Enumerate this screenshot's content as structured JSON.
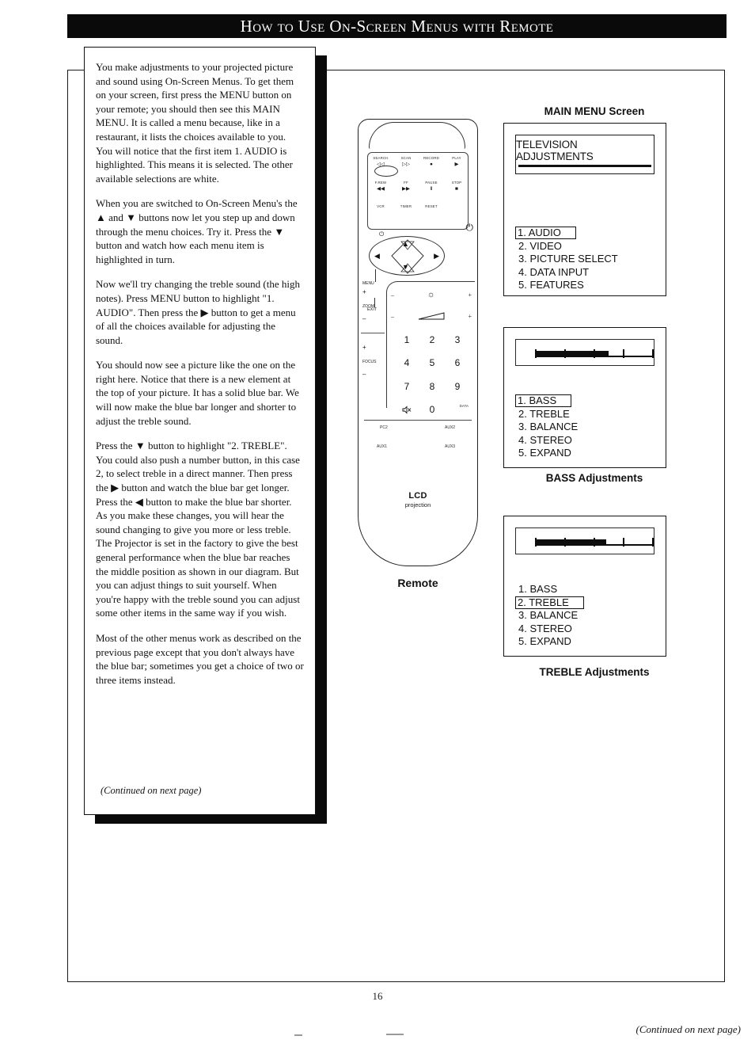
{
  "header": {
    "title": "How to Use On-Screen Menus with Remote"
  },
  "left_column": {
    "paragraphs": [
      "You  make adjustments to your projected picture and sound using On-Screen Menus. To get them on your screen, first press the MENU button on your remote; you should then see this MAIN MENU. It is called a menu  because, like in a restaurant, it lists the choices available to you.  You will notice that the first item 1. AUDIO is highlighted. This means it is selected. The other available selections are white.",
      "When you are switched  to On-Screen Menu's the ▲ and ▼  buttons now let you step up and down through the menu choices. Try it. Press the ▼ button and watch how each menu item is highlighted in turn.",
      "Now we'll try changing the treble sound (the high notes).  Press MENU button to highlight \"1. AUDIO\". Then press the ▶ button to get a menu of all the choices available for adjusting the sound.",
      "You should now see a picture like the one on the right here. Notice that there is a new element at the top of your picture. It has a solid blue bar. We will now make the blue bar longer and shorter to adjust the treble sound.",
      "Press the ▼ button to highlight \"2. TREBLE\". You could also push a number button, in this case 2, to select treble in a direct manner. Then press the ▶ button and watch the blue bar get longer.  Press the ◀ button to make the blue bar shorter. As you make these changes, you will hear the sound changing to give you more or less treble. The Projector is set in the factory to give the best general performance when the blue bar reaches the middle position as shown in our diagram.  But you can adjust things to suit yourself. When you're happy with the treble sound you can adjust some other items in the same way if you wish.",
      "Most of the other menus work as described on the previous page except that you don't always have the blue bar; sometimes you get a choice of two or three items instead."
    ],
    "continued_note": "(Continued on next page)"
  },
  "remote": {
    "caption": "Remote",
    "brand_main": "LCD",
    "brand_sub": "projection",
    "vcr_labels": [
      "SEARCH",
      "SCAN",
      "RECORD",
      "PLAY",
      "F.REW",
      "FF",
      "PAUSE",
      "STOP",
      "VCR",
      "TIMER",
      "RESET"
    ],
    "vcr_icons": [
      "◁◁",
      "▷▷",
      "●",
      "▶",
      "◀◀",
      "▶▶",
      "Ⅱ",
      "■"
    ],
    "power_icon": "⏻",
    "nav_up": "▲",
    "nav_down": "▼",
    "nav_left": "◀",
    "nav_right": "▶",
    "menu_label": "MENU",
    "exit_label": "EXIT",
    "brightness_minus": "–",
    "brightness_plus": "+",
    "brightness_icon": "☼",
    "volume_minus": "–",
    "volume_plus": "+",
    "zoom_label": "ZOOM",
    "zoom_plus": "+",
    "zoom_minus": "–",
    "focus_label": "FOCUS",
    "focus_plus": "+",
    "focus_minus": "–",
    "keys": [
      "1",
      "2",
      "3",
      "4",
      "5",
      "6",
      "7",
      "8",
      "9",
      "ὐ7",
      "0",
      ""
    ],
    "mute_icon": "ὐ7",
    "data_label": "DATA",
    "aux_labels": [
      "PC2",
      "AUX2",
      "AUX1",
      "AUX3"
    ]
  },
  "screens": {
    "main_menu": {
      "caption": "MAIN MENU Screen",
      "title": "TELEVISION ADJUSTMENTS",
      "items": [
        "1. AUDIO",
        "2. VIDEO",
        "3. PICTURE SELECT",
        "4. DATA INPUT",
        "5. FEATURES"
      ],
      "selected_index": 0
    },
    "bass": {
      "caption": "BASS Adjustments",
      "items": [
        "1. BASS",
        "2. TREBLE",
        "3. BALANCE",
        "4. STEREO",
        "5. EXPAND"
      ],
      "selected_index": 0,
      "bar_fill_percent": 62,
      "bar_ticks_percent": [
        0,
        25,
        50,
        75,
        100
      ]
    },
    "treble": {
      "caption": "TREBLE Adjustments",
      "items": [
        "1. BASS",
        "2. TREBLE",
        "3. BALANCE",
        "4. STEREO",
        "5. EXPAND"
      ],
      "selected_index": 1,
      "bar_fill_percent": 60,
      "bar_ticks_percent": [
        0,
        25,
        50,
        75,
        100
      ]
    }
  },
  "footer": {
    "continued_note": "(Continued on next page)",
    "page_number": "16"
  }
}
